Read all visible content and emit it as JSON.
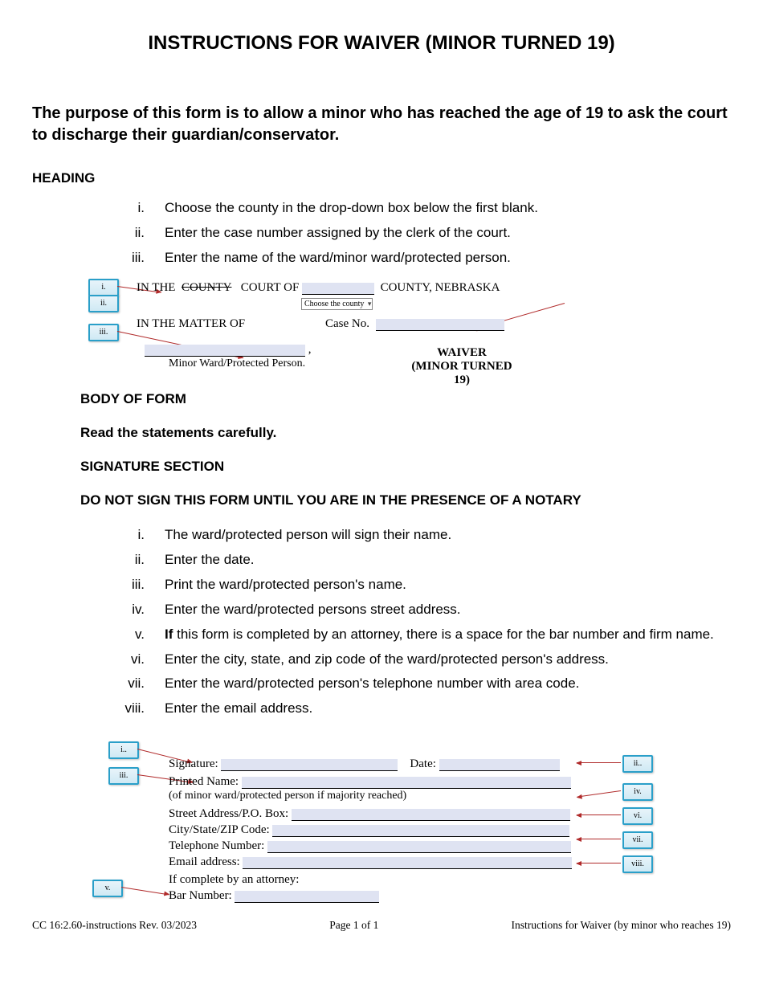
{
  "title": "INSTRUCTIONS FOR WAIVER (MINOR TURNED 19)",
  "purpose": "The purpose of this form is to allow a minor who has reached the age of 19 to ask the court to discharge their guardian/conservator.",
  "heading_label": "HEADING",
  "heading_items": {
    "i": "Choose the county in the drop-down box below the first blank.",
    "ii": "Enter the case number assigned by the clerk of the court.",
    "iii": "Enter the name of the ward/minor ward/protected person."
  },
  "sample1": {
    "in_the": "IN THE",
    "county_strike": "COUNTY",
    "court_of": "COURT OF",
    "county_nebraska": "COUNTY, NEBRASKA",
    "dropdown": "Choose the county",
    "in_matter": "IN THE MATTER OF",
    "case_no": "Case No.",
    "minor_label": "Minor Ward/Protected Person.",
    "waiver": "WAIVER",
    "sub": "(MINOR TURNED 19)",
    "callouts": {
      "i": "i.",
      "ii": "ii.",
      "iii": "iii."
    }
  },
  "body_label": "BODY OF FORM",
  "read_label": "Read the statements carefully.",
  "sig_label": "SIGNATURE SECTION",
  "notary_label": "DO NOT SIGN THIS FORM UNTIL YOU ARE IN THE PRESENCE OF A NOTARY",
  "sig_items": {
    "i": "The ward/protected person will sign their name.",
    "ii": "Enter the date.",
    "iii": "Print the ward/protected person's name.",
    "iv": "Enter the ward/protected persons street address.",
    "v_pre": "If",
    "v": " this form is completed by an attorney, there is a space for the bar number and firm name.",
    "vi": "Enter the city, state, and zip code of the ward/protected person's address.",
    "vii": "Enter the ward/protected person's telephone number with area code.",
    "viii": "Enter the email address."
  },
  "sample2": {
    "signature": "Signature:",
    "date": "Date:",
    "printed": "Printed Name:",
    "of_minor": "(of minor ward/protected person if majority reached)",
    "street": "Street Address/P.O. Box:",
    "city": "City/State/ZIP Code:",
    "tel": "Telephone Number:",
    "email": "Email address:",
    "attorney": "If complete by an attorney:",
    "bar": "Bar Number:",
    "callouts": {
      "i": "i..",
      "ii": "ii..",
      "iii": "iii.",
      "iv": "iv.",
      "v": "v.",
      "vi": "vi.",
      "vii": "vii.",
      "viii": "viii."
    }
  },
  "footer": {
    "left": "CC 16:2.60-instructions Rev. 03/2023",
    "center": "Page 1 of 1",
    "right": "Instructions for Waiver (by minor who reaches 19)"
  },
  "romans": {
    "i": "i.",
    "ii": "ii.",
    "iii": "iii.",
    "iv": "iv.",
    "v": "v.",
    "vi": "vi.",
    "vii": "vii.",
    "viii": "viii."
  }
}
